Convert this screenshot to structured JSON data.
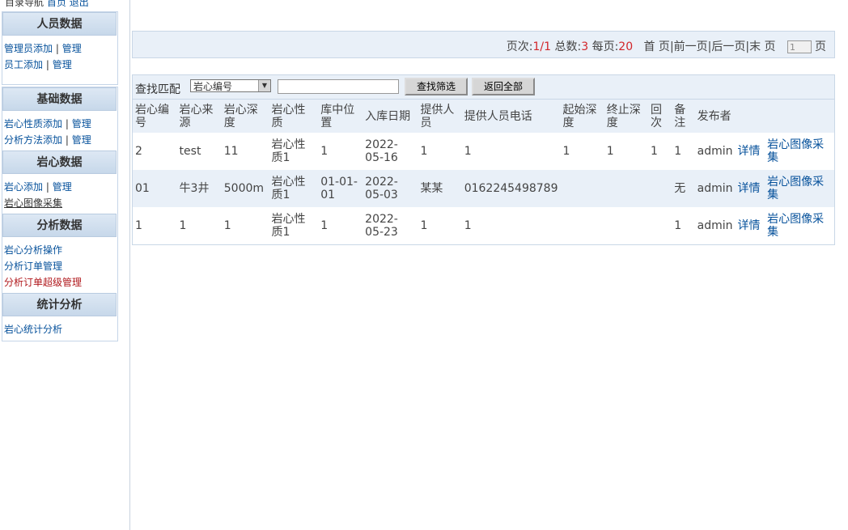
{
  "sidebar": {
    "top": {
      "label": "目录导航",
      "home": "首页",
      "exit": "退出"
    },
    "sections": [
      {
        "title": "人员数据",
        "links": [
          {
            "text": "管理员添加",
            "sep": " | ",
            "text2": "管理"
          },
          {
            "text": "员工添加",
            "sep": " | ",
            "text2": "管理"
          }
        ]
      },
      {
        "title": "基础数据",
        "links": [
          {
            "text": "岩心性质添加",
            "sep": " | ",
            "text2": "管理"
          },
          {
            "text": "分析方法添加",
            "sep": " | ",
            "text2": "管理"
          }
        ]
      },
      {
        "title": "岩心数据",
        "links": [
          {
            "text": "岩心添加",
            "sep": " | ",
            "text2": "管理"
          },
          {
            "text": "岩心图像采集"
          }
        ]
      },
      {
        "title": "分析数据",
        "links": [
          {
            "text": "岩心分析操作"
          },
          {
            "text": "分析订单管理"
          },
          {
            "text": "分析订单超级管理"
          }
        ]
      },
      {
        "title": "统计分析",
        "links": [
          {
            "text": "岩心统计分析"
          }
        ]
      }
    ]
  },
  "pager": {
    "page_label": "页次:",
    "page_value": "1/1",
    "total_label": "总数:",
    "total_value": "3",
    "per_label": "每页:",
    "per_value": "20",
    "first": "首 页",
    "prev": "前一页",
    "next": "后一页",
    "last": "末 页",
    "input_value": "1",
    "page_suffix": "页"
  },
  "search": {
    "label": "查找匹配",
    "select_value": "岩心编号",
    "filter_button": "查找筛选",
    "reset_button": "返回全部"
  },
  "table": {
    "headers": [
      "岩心编号",
      "岩心来源",
      "岩心深度",
      "岩心性质",
      "库中位置",
      "入库日期",
      "提供人员",
      "提供人员电话",
      "起始深度",
      "终止深度",
      "回次",
      "备注",
      "发布者",
      "",
      ""
    ],
    "rows": [
      [
        "2",
        "test",
        "11",
        "岩心性质1",
        "1",
        "2022-05-16",
        "1",
        "1",
        "1",
        "1",
        "1",
        "1",
        "admin",
        "详情",
        "岩心图像采集"
      ],
      [
        "01",
        "牛3井",
        "5000m",
        "岩心性质1",
        "01-01-01",
        "2022-05-03",
        "某某",
        "0162245498789",
        "",
        "",
        "",
        "无",
        "admin",
        "详情",
        "岩心图像采集"
      ],
      [
        "1",
        "1",
        "1",
        "岩心性质1",
        "1",
        "2022-05-23",
        "1",
        "1",
        "",
        "",
        "",
        "1",
        "admin",
        "详情",
        "岩心图像采集"
      ]
    ]
  }
}
